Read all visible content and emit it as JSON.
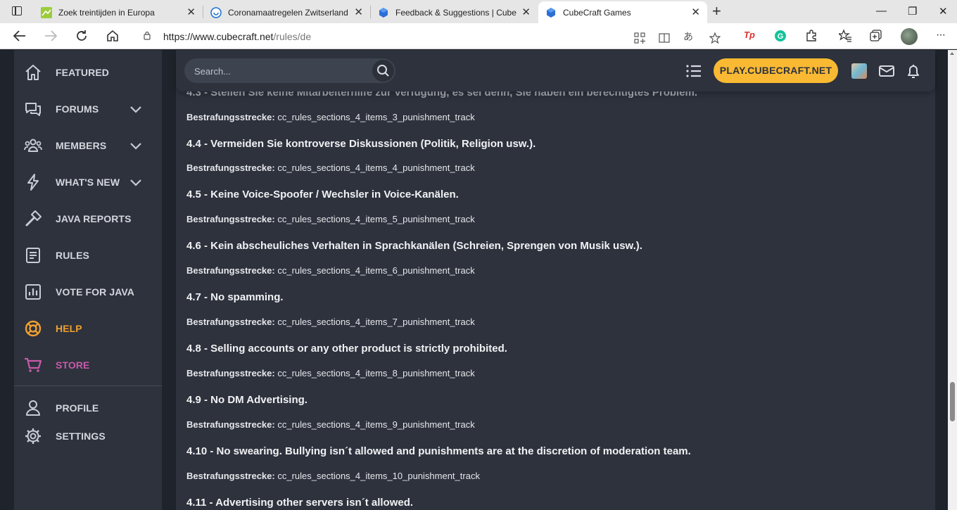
{
  "browser": {
    "tabs": [
      {
        "title": "Zoek treintijden in Europa",
        "active": false
      },
      {
        "title": "Coronamaatregelen Zwitserland",
        "active": false
      },
      {
        "title": "Feedback & Suggestions | CubeC",
        "active": false
      },
      {
        "title": "CubeCraft Games",
        "active": true
      }
    ],
    "new_tab": "+",
    "close": "✕",
    "address": {
      "host": "https://www.cubecraft.net",
      "path": "/rules/de"
    },
    "window_controls": {
      "minimize": "—",
      "restore": "❐",
      "close": "✕"
    }
  },
  "sidebar": {
    "items": [
      {
        "label": "FEATURED",
        "icon": "home-icon"
      },
      {
        "label": "FORUMS",
        "icon": "chat-icon"
      },
      {
        "label": "MEMBERS",
        "icon": "members-icon"
      },
      {
        "label": "WHAT'S NEW",
        "icon": "lightning-icon"
      },
      {
        "label": "JAVA REPORTS",
        "icon": "hammer-icon"
      },
      {
        "label": "RULES",
        "icon": "rules-icon"
      },
      {
        "label": "VOTE FOR JAVA",
        "icon": "chart-icon"
      },
      {
        "label": "HELP",
        "icon": "lifebuoy-icon"
      },
      {
        "label": "STORE",
        "icon": "cart-icon"
      }
    ],
    "bottom": [
      {
        "label": "PROFILE",
        "icon": "user-icon"
      },
      {
        "label": "SETTINGS",
        "icon": "gear-icon"
      }
    ],
    "colors": {
      "help": "#f0a030",
      "store": "#c85aa8",
      "default": "#d3d6dc"
    }
  },
  "header": {
    "search_placeholder": "Search...",
    "play_button": "PLAY.CUBECRAFT.NET",
    "accent": "#f9b932"
  },
  "rules": {
    "partial_top": "4.3 - Stellen Sie keine Mitarbeiterhilfe zur Verfügung, es sei denn, Sie haben ein berechtigtes Problem.",
    "items": [
      {
        "title": "",
        "track_label": "Bestrafungsstrecke:",
        "track": "cc_rules_sections_4_items_3_punishment_track"
      },
      {
        "title": "4.4 - Vermeiden Sie kontroverse Diskussionen (Politik, Religion usw.).",
        "track_label": "Bestrafungsstrecke:",
        "track": "cc_rules_sections_4_items_4_punishment_track"
      },
      {
        "title": "4.5 - Keine Voice-Spoofer / Wechsler in Voice-Kanälen.",
        "track_label": "Bestrafungsstrecke:",
        "track": "cc_rules_sections_4_items_5_punishment_track"
      },
      {
        "title": "4.6 - Kein abscheuliches Verhalten in Sprachkanälen (Schreien, Sprengen von Musik usw.).",
        "track_label": "Bestrafungsstrecke:",
        "track": "cc_rules_sections_4_items_6_punishment_track"
      },
      {
        "title": "4.7 - No spamming.",
        "track_label": "Bestrafungsstrecke:",
        "track": "cc_rules_sections_4_items_7_punishment_track"
      },
      {
        "title": "4.8 - Selling accounts or any other product is strictly prohibited.",
        "track_label": "Bestrafungsstrecke:",
        "track": "cc_rules_sections_4_items_8_punishment_track"
      },
      {
        "title": "4.9 - No DM Advertising.",
        "track_label": "Bestrafungsstrecke:",
        "track": "cc_rules_sections_4_items_9_punishment_track"
      },
      {
        "title": "4.10 - No swearing. Bullying isn´t allowed and punishments are at the discretion of moderation team.",
        "track_label": "Bestrafungsstrecke:",
        "track": "cc_rules_sections_4_items_10_punishment_track"
      },
      {
        "title": "4.11 - Advertising other servers isn´t allowed.",
        "track_label": "",
        "track": ""
      }
    ]
  }
}
